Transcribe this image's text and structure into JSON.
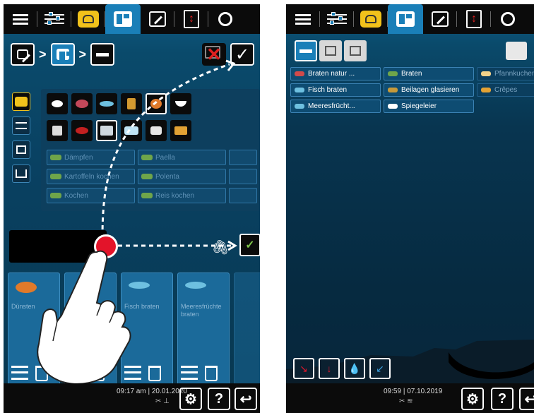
{
  "left_panel": {
    "breadcrumb_separator": ">",
    "confirm_symbol": "✓",
    "cancel_symbol": "✕",
    "category_pills": [
      [
        "Dämpfen",
        "Paella",
        ""
      ],
      [
        "Kartoffeln kochen",
        "Polenta",
        ""
      ],
      [
        "Kochen",
        "Reis kochen",
        ""
      ]
    ],
    "cards": [
      {
        "label": "Dünsten"
      },
      {
        "label": ""
      },
      {
        "label": "Fisch braten"
      },
      {
        "label": "Meeresfrüchte braten"
      },
      {
        "label": ""
      }
    ],
    "status": {
      "time": "09:17 am",
      "divider": "|",
      "date": "20.01.2020"
    },
    "bottom_buttons": {
      "help": "?",
      "back": "↩"
    }
  },
  "right_panel": {
    "list": [
      [
        {
          "label": "Braten natur ...",
          "color": "#d14a4a"
        },
        {
          "label": "Braten",
          "color": "#6fa54a"
        },
        {
          "label": "Pfannkuchen",
          "color": "#f2d28a"
        }
      ],
      [
        {
          "label": "Fisch braten",
          "color": "#6ec0e0"
        },
        {
          "label": "Beilagen glasieren",
          "color": "#c79a3a"
        },
        {
          "label": "Crêpes",
          "color": "#e3a234"
        }
      ],
      [
        {
          "label": "Meeresfrücht...",
          "color": "#6ec0e0"
        },
        {
          "label": "Spiegeleier",
          "color": "#ffffff"
        }
      ]
    ],
    "status": {
      "time": "09:59",
      "divider": "|",
      "date": "07.10.2019"
    },
    "bottom_buttons": {
      "help": "?",
      "back": "↩"
    }
  },
  "colors": {
    "accent": "#1a7fb8",
    "highlight": "#f1c21b",
    "alert": "#e3142a",
    "confirm": "#7ec24a"
  },
  "icons": [
    "menu-icon",
    "sliders-icon",
    "toque-icon",
    "program-grid-icon",
    "edit-icon",
    "sort-icon",
    "search-icon",
    "clip-icon",
    "checklist-icon",
    "trash-icon",
    "settings-icon",
    "help-icon",
    "back-icon"
  ]
}
